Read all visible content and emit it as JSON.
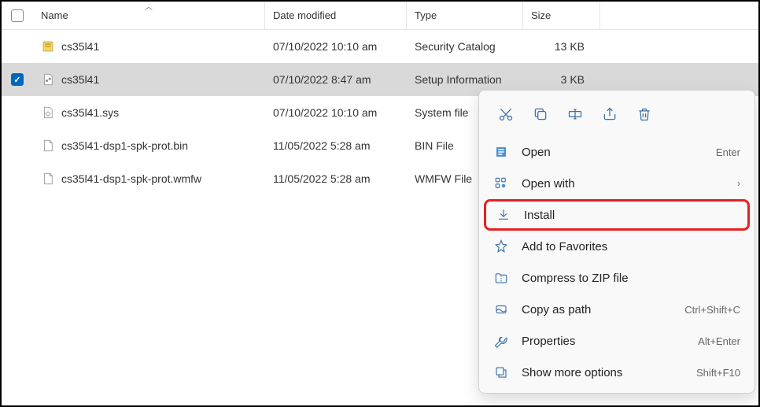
{
  "columns": {
    "name": "Name",
    "date": "Date modified",
    "type": "Type",
    "size": "Size"
  },
  "files": [
    {
      "name": "cs35l41",
      "date": "07/10/2022 10:10 am",
      "type": "Security Catalog",
      "size": "13 KB",
      "icon": "catalog",
      "selected": false
    },
    {
      "name": "cs35l41",
      "date": "07/10/2022 8:47 am",
      "type": "Setup Information",
      "size": "3 KB",
      "icon": "inf",
      "selected": true
    },
    {
      "name": "cs35l41.sys",
      "date": "07/10/2022 10:10 am",
      "type": "System file",
      "size": "",
      "icon": "sys",
      "selected": false
    },
    {
      "name": "cs35l41-dsp1-spk-prot.bin",
      "date": "11/05/2022 5:28 am",
      "type": "BIN File",
      "size": "",
      "icon": "generic",
      "selected": false
    },
    {
      "name": "cs35l41-dsp1-spk-prot.wmfw",
      "date": "11/05/2022 5:28 am",
      "type": "WMFW File",
      "size": "",
      "icon": "generic",
      "selected": false
    }
  ],
  "context_menu": {
    "open": {
      "label": "Open",
      "shortcut": "Enter"
    },
    "open_with": {
      "label": "Open with",
      "shortcut": ""
    },
    "install": {
      "label": "Install",
      "shortcut": ""
    },
    "favorites": {
      "label": "Add to Favorites",
      "shortcut": ""
    },
    "compress": {
      "label": "Compress to ZIP file",
      "shortcut": ""
    },
    "copy_path": {
      "label": "Copy as path",
      "shortcut": "Ctrl+Shift+C"
    },
    "properties": {
      "label": "Properties",
      "shortcut": "Alt+Enter"
    },
    "more": {
      "label": "Show more options",
      "shortcut": "Shift+F10"
    }
  }
}
